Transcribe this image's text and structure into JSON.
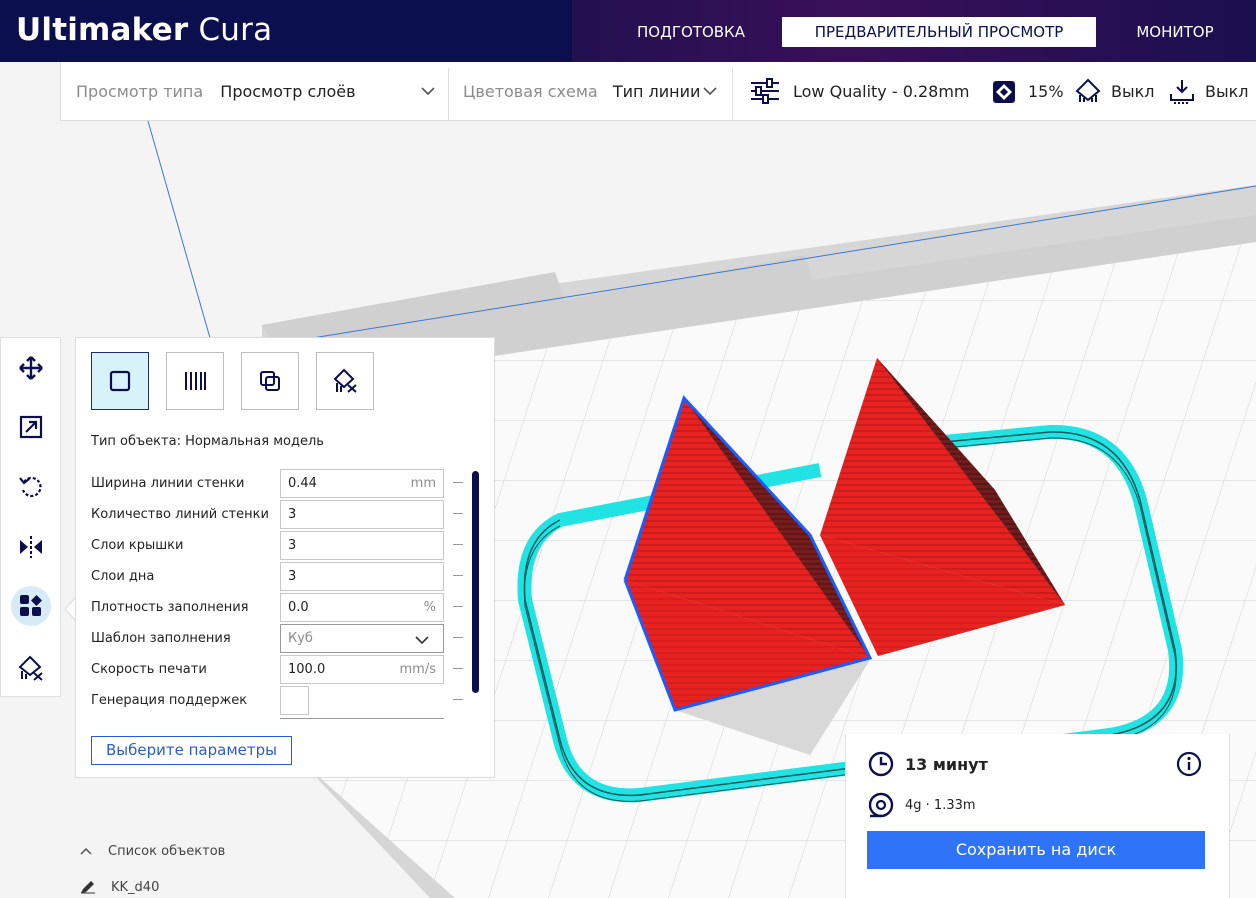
{
  "app": {
    "brand_bold": "Ultimaker",
    "brand_light": "Cura"
  },
  "nav": {
    "prepare": "ПОДГОТОВКА",
    "preview": "ПРЕДВАРИТЕЛЬНЫЙ ПРОСМОТР",
    "monitor": "МОНИТОР"
  },
  "toolbar": {
    "view_type_label": "Просмотр типа",
    "view_type_value": "Просмотр слоёв",
    "color_scheme_label": "Цветовая схема",
    "color_scheme_value": "Тип линии",
    "profile": "Low Quality - 0.28mm",
    "infill": "15%",
    "support": "Выкл",
    "adhesion": "Выкл"
  },
  "panel": {
    "object_type": "Тип объекта: Нормальная модель",
    "settings": [
      {
        "label": "Ширина линии стенки",
        "value": "0.44",
        "unit": "mm"
      },
      {
        "label": "Количество линий стенки",
        "value": "3",
        "unit": ""
      },
      {
        "label": "Слои крышки",
        "value": "3",
        "unit": ""
      },
      {
        "label": "Слои дна",
        "value": "3",
        "unit": ""
      },
      {
        "label": "Плотность заполнения",
        "value": "0.0",
        "unit": "%"
      },
      {
        "label": "Шаблон заполнения",
        "value": "Куб",
        "unit": ""
      },
      {
        "label": "Скорость печати",
        "value": "100.0",
        "unit": "mm/s"
      },
      {
        "label": "Генерация поддержек",
        "value": "",
        "unit": ""
      }
    ],
    "select_params_button": "Выберите параметры"
  },
  "object_list": {
    "title": "Список объектов",
    "item": "KK_d40"
  },
  "print_info": {
    "time": "13 минут",
    "material": "4g · 1.33m",
    "save_button": "Сохранить на диск"
  },
  "colors": {
    "header_bg": "#0b0f4d",
    "accent_blue": "#2f74f8",
    "model_red": "#e82121",
    "skirt_cyan": "#22e3e3",
    "selection_blue": "#1a5cff"
  }
}
